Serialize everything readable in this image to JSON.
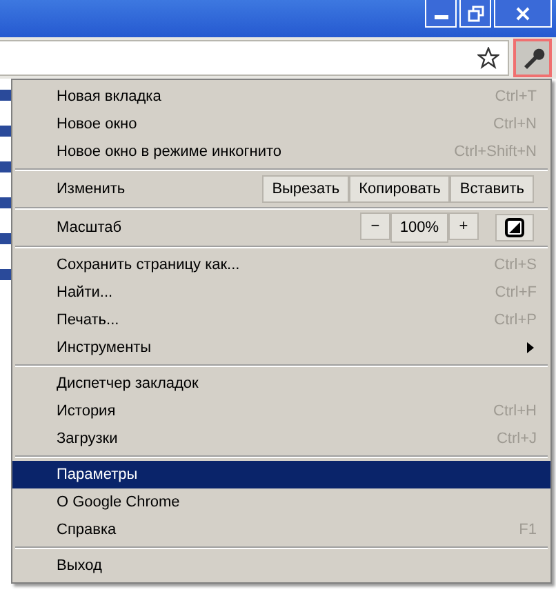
{
  "toolbar": {
    "wrench_pressed": true
  },
  "menu": {
    "sections": [
      [
        {
          "kind": "item",
          "label": "Новая вкладка",
          "shortcut": "Ctrl+T",
          "selected": false
        },
        {
          "kind": "item",
          "label": "Новое окно",
          "shortcut": "Ctrl+N",
          "selected": false
        },
        {
          "kind": "item",
          "label": "Новое окно в режиме инкогнито",
          "shortcut": "Ctrl+Shift+N",
          "selected": false
        }
      ],
      [
        {
          "kind": "edit",
          "label": "Изменить",
          "buttons": [
            "Вырезать",
            "Копировать",
            "Вставить"
          ]
        }
      ],
      [
        {
          "kind": "zoom",
          "label": "Масштаб",
          "minus": "−",
          "value": "100%",
          "plus": "+"
        }
      ],
      [
        {
          "kind": "item",
          "label": "Сохранить страницу как...",
          "shortcut": "Ctrl+S",
          "selected": false
        },
        {
          "kind": "item",
          "label": "Найти...",
          "shortcut": "Ctrl+F",
          "selected": false
        },
        {
          "kind": "item",
          "label": "Печать...",
          "shortcut": "Ctrl+P",
          "selected": false
        },
        {
          "kind": "submenu",
          "label": "Инструменты",
          "selected": false
        }
      ],
      [
        {
          "kind": "item",
          "label": "Диспетчер закладок",
          "selected": false
        },
        {
          "kind": "item",
          "label": "История",
          "shortcut": "Ctrl+H",
          "selected": false
        },
        {
          "kind": "item",
          "label": "Загрузки",
          "shortcut": "Ctrl+J",
          "selected": false
        }
      ],
      [
        {
          "kind": "item",
          "label": "Параметры",
          "selected": true
        },
        {
          "kind": "item",
          "label": "О Google Chrome",
          "selected": false
        },
        {
          "kind": "item",
          "label": "Справка",
          "shortcut": "F1",
          "selected": false
        }
      ],
      [
        {
          "kind": "item",
          "label": "Выход",
          "selected": false
        }
      ]
    ]
  }
}
